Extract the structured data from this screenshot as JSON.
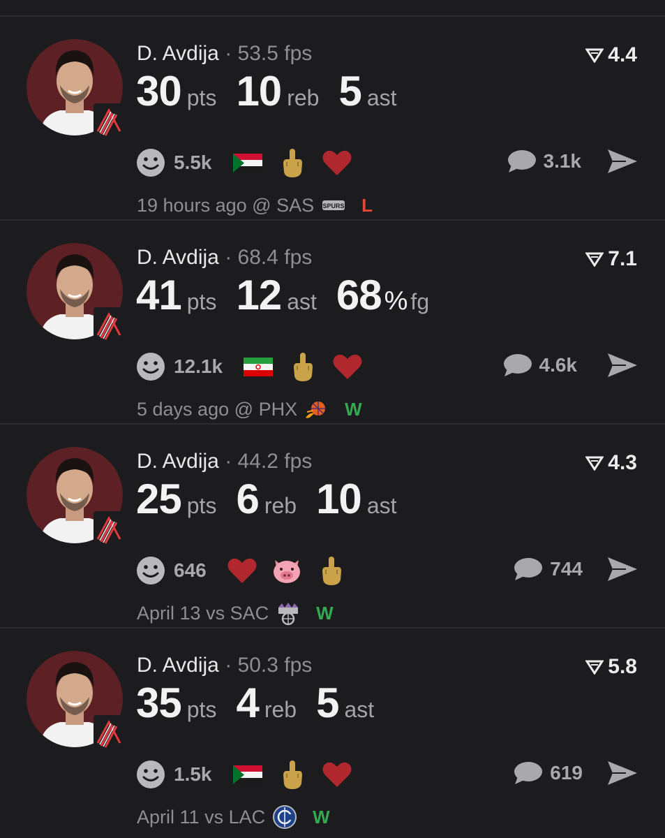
{
  "colors": {
    "background": "#1c1c1e",
    "win": "#34a853",
    "loss": "#e0463a",
    "avatar_bg": "#5c2025"
  },
  "posts": [
    {
      "player": "D. Avdija",
      "separator": "·",
      "fps": "53.5 fps",
      "score": "4.4",
      "stats": [
        {
          "value": "30",
          "unit": "pts"
        },
        {
          "value": "10",
          "unit": "reb"
        },
        {
          "value": "5",
          "unit": "ast"
        }
      ],
      "reaction_count": "5.5k",
      "emojis": [
        "flag-sudan-icon",
        "middle-finger-icon",
        "heart-icon"
      ],
      "comments": "3.1k",
      "time": "19 hours ago",
      "venue": "@",
      "opponent": "SAS",
      "opponent_logo": "spurs-logo-icon",
      "result": "L"
    },
    {
      "player": "D. Avdija",
      "separator": "·",
      "fps": "68.4 fps",
      "score": "7.1",
      "stats": [
        {
          "value": "41",
          "unit": "pts"
        },
        {
          "value": "12",
          "unit": "ast"
        },
        {
          "value": "68",
          "pct": "%",
          "unit": "fg"
        }
      ],
      "reaction_count": "12.1k",
      "emojis": [
        "flag-iran-icon",
        "middle-finger-icon",
        "heart-icon"
      ],
      "comments": "4.6k",
      "time": "5 days ago",
      "venue": "@",
      "opponent": "PHX",
      "opponent_logo": "suns-logo-icon",
      "result": "W"
    },
    {
      "player": "D. Avdija",
      "separator": "·",
      "fps": "44.2 fps",
      "score": "4.3",
      "stats": [
        {
          "value": "25",
          "unit": "pts"
        },
        {
          "value": "6",
          "unit": "reb"
        },
        {
          "value": "10",
          "unit": "ast"
        }
      ],
      "reaction_count": "646",
      "emojis": [
        "heart-icon",
        "pig-face-icon",
        "middle-finger-icon"
      ],
      "comments": "744",
      "time": "April 13",
      "venue": "vs",
      "opponent": "SAC",
      "opponent_logo": "kings-logo-icon",
      "result": "W"
    },
    {
      "player": "D. Avdija",
      "separator": "·",
      "fps": "50.3 fps",
      "score": "5.8",
      "stats": [
        {
          "value": "35",
          "unit": "pts"
        },
        {
          "value": "4",
          "unit": "reb"
        },
        {
          "value": "5",
          "unit": "ast"
        }
      ],
      "reaction_count": "1.5k",
      "emojis": [
        "flag-sudan-icon",
        "middle-finger-icon",
        "heart-icon"
      ],
      "comments": "619",
      "time": "April 11",
      "venue": "vs",
      "opponent": "LAC",
      "opponent_logo": "clippers-logo-icon",
      "result": "W"
    }
  ]
}
